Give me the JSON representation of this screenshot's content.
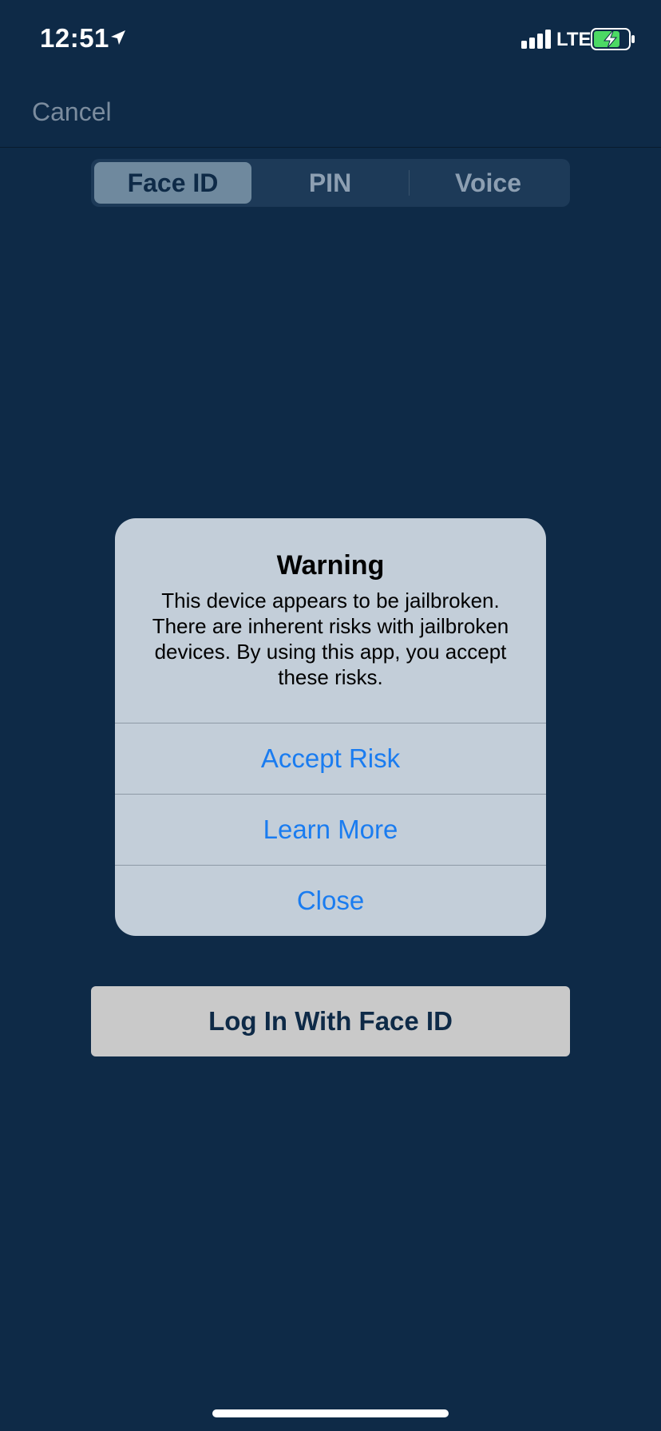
{
  "status_bar": {
    "time": "12:51",
    "network": "LTE",
    "icons": [
      "location-arrow-icon",
      "signal-bars-icon",
      "battery-charging-icon"
    ],
    "battery_color": "#4cd964"
  },
  "nav": {
    "cancel_label": "Cancel"
  },
  "auth_tabs": [
    {
      "label": "Face ID",
      "selected": true
    },
    {
      "label": "PIN",
      "selected": false
    },
    {
      "label": "Voice",
      "selected": false
    }
  ],
  "alert": {
    "title": "Warning",
    "message": "This device appears to be jailbroken. There are inherent risks with jailbroken devices. By using this app, you accept these risks.",
    "actions": [
      {
        "label": "Accept Risk"
      },
      {
        "label": "Learn More"
      },
      {
        "label": "Close"
      }
    ]
  },
  "login_button_label": "Log In With Face ID",
  "colors": {
    "background": "#0e2a47",
    "alert_background": "#c3ced9",
    "action_text": "#1a7cf0",
    "login_button": "#c9c9c9"
  }
}
